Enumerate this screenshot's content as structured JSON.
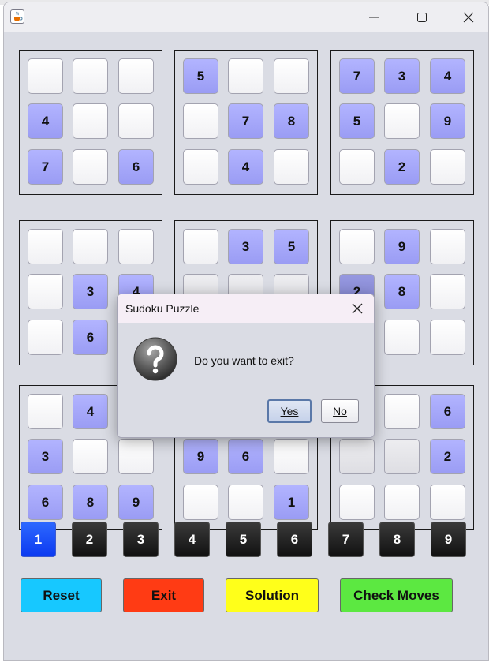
{
  "window": {
    "app_icon": "java-cup-icon",
    "controls": {
      "minimize_icon": "minimize-icon",
      "maximize_icon": "maximize-icon",
      "close_icon": "close-icon"
    }
  },
  "board": {
    "blocks": [
      [
        "",
        "",
        "",
        "4",
        "",
        "",
        "7",
        "",
        "6"
      ],
      [
        "5",
        "",
        "",
        "",
        "7",
        "8",
        "",
        "4",
        ""
      ],
      [
        "7",
        "3",
        "4",
        "5",
        "",
        "9",
        "",
        "2",
        ""
      ],
      [
        "",
        "",
        "",
        "",
        "3",
        "4",
        "",
        "6",
        ""
      ],
      [
        "",
        "3",
        "5",
        "",
        "",
        "",
        "",
        "",
        ""
      ],
      [
        "",
        "9",
        "",
        "2",
        "8",
        "",
        "",
        "",
        ""
      ],
      [
        "",
        "4",
        "",
        "3",
        "",
        "",
        "6",
        "8",
        "9"
      ],
      [
        "",
        "",
        "",
        "9",
        "6",
        "",
        "",
        "",
        "1"
      ],
      [
        "",
        "",
        "6",
        "",
        "",
        "2",
        "",
        "",
        ""
      ]
    ]
  },
  "number_pad": {
    "labels": [
      "1",
      "2",
      "3",
      "4",
      "5",
      "6",
      "7",
      "8",
      "9"
    ],
    "selected": "1"
  },
  "actions": {
    "reset": "Reset",
    "exit": "Exit",
    "solution": "Solution",
    "check": "Check Moves"
  },
  "dialog": {
    "title": "Sudoku Puzzle",
    "message": "Do you want to exit?",
    "yes": "Yes",
    "no": "No",
    "icon": "question-icon"
  },
  "colors": {
    "given_cell": "#a8aaff",
    "empty_cell": "#ffffff",
    "selected_number": "#1a4cff",
    "number_key": "#1c1c1c",
    "reset": "#17c8ff",
    "exit": "#ff3b14",
    "solution": "#ffff1a",
    "check": "#5ce841",
    "board_background": "#dadce4"
  }
}
